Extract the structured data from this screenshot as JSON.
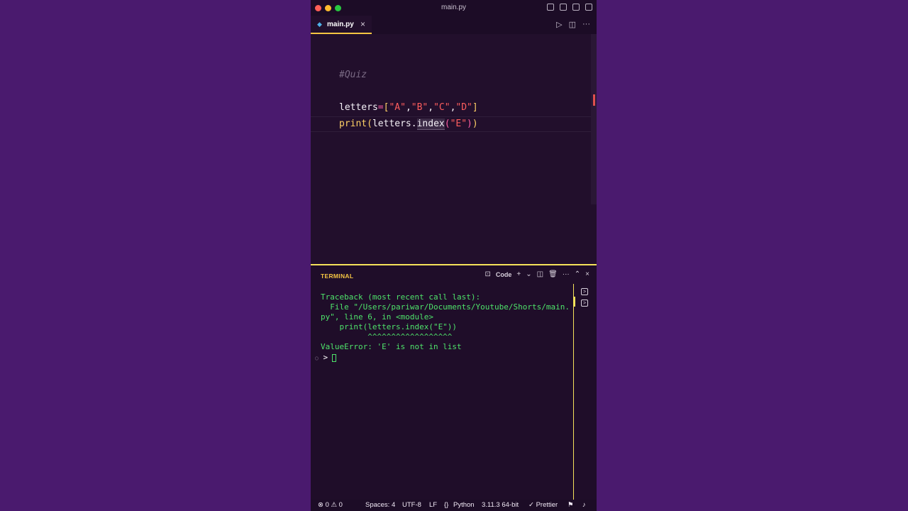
{
  "window": {
    "title": "main.py"
  },
  "tab": {
    "icon": "python-file-icon",
    "label": "main.py",
    "close": "×"
  },
  "editor": {
    "comment": "#Quiz",
    "line1": {
      "var": "letters",
      "eq": "=",
      "lb": "[",
      "a": "\"A\"",
      "c1": ",",
      "b": "\"B\"",
      "c2": ",",
      "c": "\"C\"",
      "c3": ",",
      "d": "\"D\"",
      "rb": "]"
    },
    "line2": {
      "fn": "print",
      "lp": "(",
      "obj": "letters.",
      "meth": "index",
      "lp2": "(",
      "arg": "\"E\"",
      "rp2": ")",
      "rp": ")"
    }
  },
  "panel": {
    "title": "TERMINAL",
    "shell_label": "Code",
    "output": "Traceback (most recent call last):\n  File \"/Users/pariwar/Documents/Youtube/Shorts/main.\npy\", line 6, in <module>\n    print(letters.index(\"E\"))\n          ^^^^^^^^^^^^^^^^^^\nValueError: 'E' is not in list",
    "prompt": ">"
  },
  "status": {
    "problems": "⊗ 0 ⚠ 0",
    "spaces": "Spaces: 4",
    "encoding": "UTF-8",
    "eol": "LF",
    "language": "Python",
    "interpreter": "3.11.3 64-bit",
    "prettier": "✓ Prettier"
  },
  "colors": {
    "background": "#4a1a6e",
    "accent": "#f5c542",
    "terminal_text": "#4ee36a"
  }
}
